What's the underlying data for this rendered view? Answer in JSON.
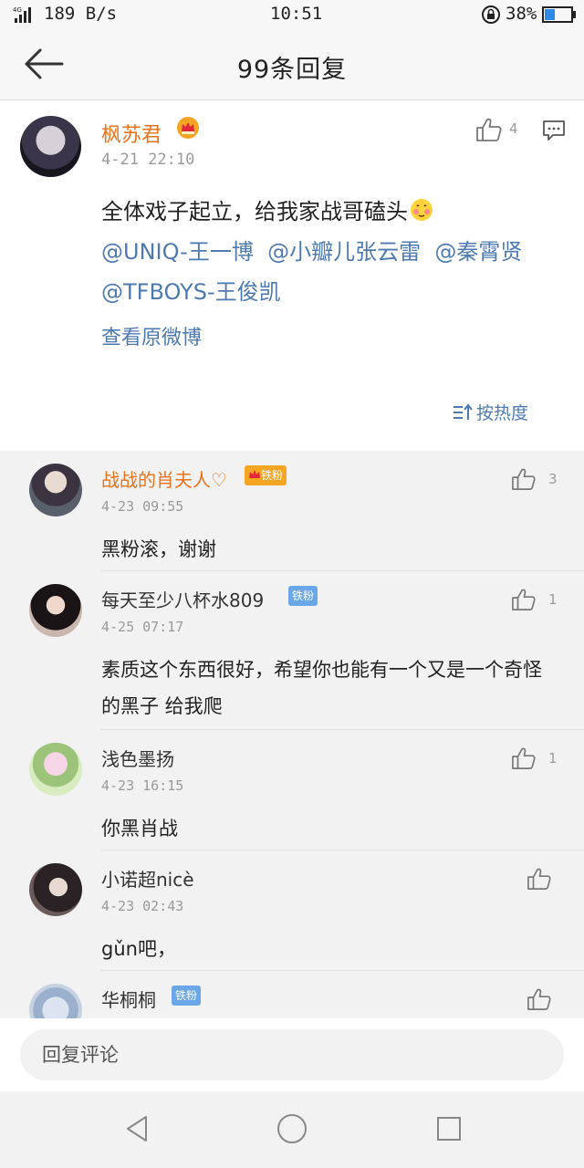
{
  "status_bar": {
    "net_speed": "189 B/s",
    "clock": "10:51",
    "battery": "38%",
    "network": "4G"
  },
  "header": {
    "title": "99条回复"
  },
  "original": {
    "name": "枫苏君",
    "time": "4-21 22:10",
    "like_count": "4",
    "text_main": "全体戏子起立，给我家战哥磕头",
    "mentions": [
      "@UNIQ-王一博",
      "@小瓣儿张云雷",
      "@秦霄贤",
      "@TFBOYS-王俊凯"
    ],
    "view_original": "查看原微博",
    "sort_label": "按热度"
  },
  "replies": [
    {
      "name": "战战的肖夫人♡",
      "badge": "铁粉",
      "time": "4-23 09:55",
      "likes": "3",
      "text": "黑粉滚，谢谢"
    },
    {
      "name": "每天至少八杯水809",
      "badge": "铁粉",
      "time": "4-25 07:17",
      "likes": "1",
      "text": "素质这个东西很好，希望你也能有一个又是一个奇怪的黑子      给我爬"
    },
    {
      "name": "浅色墨扬",
      "time": "4-23 16:15",
      "likes": "1",
      "text": "你黑肖战"
    },
    {
      "name": "小诺超nicè",
      "time": "4-23 02:43",
      "likes": "",
      "text": "gǔn吧，"
    },
    {
      "name": "华桐桐",
      "badge": "铁粉",
      "time": "",
      "likes": "",
      "text": ""
    }
  ],
  "input": {
    "placeholder": "回复评论"
  },
  "colors": {
    "accent_link": "#4d7ab0",
    "name_orange": "#e8731b",
    "badge_gold": "#f4a623",
    "badge_blue": "#6aa7e8"
  }
}
